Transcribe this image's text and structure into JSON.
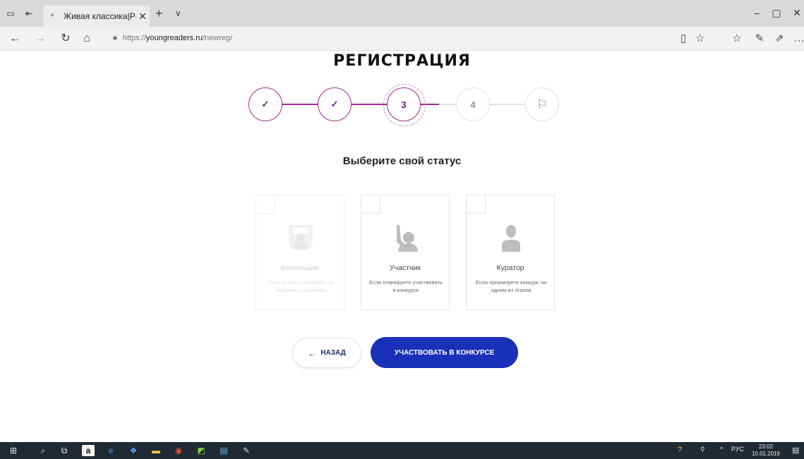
{
  "browser": {
    "tab_title": "Живая классика|Регист",
    "tab_close": "✕",
    "new_tab": "+",
    "tab_menu": "∨",
    "url_scheme": "https://",
    "url_host": "youngreaders.ru",
    "url_path": "/newreg/"
  },
  "page": {
    "title": "РЕГИСТРАЦИЯ",
    "subtitle": "Выберите свой статус"
  },
  "stepper": {
    "steps": [
      {
        "label": "✓",
        "state": "done"
      },
      {
        "label": "✓",
        "state": "done"
      },
      {
        "label": "3",
        "state": "current"
      },
      {
        "label": "4",
        "state": "todo"
      },
      {
        "label": "⚐",
        "state": "todo"
      }
    ]
  },
  "cards": [
    {
      "name": "Болельщик",
      "desc": "Если хотите голосовать за любимого участника",
      "icon": "fan-icon",
      "enabled": false
    },
    {
      "name": "Участник",
      "desc": "Если планируете участвовать в конкурсе",
      "icon": "raised-hand-icon",
      "enabled": true
    },
    {
      "name": "Куратор",
      "desc": "Если организуете конкурс на одном из этапов",
      "icon": "person-icon",
      "enabled": true
    }
  ],
  "buttons": {
    "back_arrow": "←",
    "back": "НАЗАД",
    "participate": "УЧАСТВОВАТЬ В КОНКУРСЕ"
  },
  "taskbar": {
    "lang": "РУС",
    "time": "23:02",
    "date": "10.01.2019"
  },
  "colors": {
    "step_done": "#a0298f",
    "primary_button": "#1930b8",
    "taskbar": "#1f2a33"
  }
}
